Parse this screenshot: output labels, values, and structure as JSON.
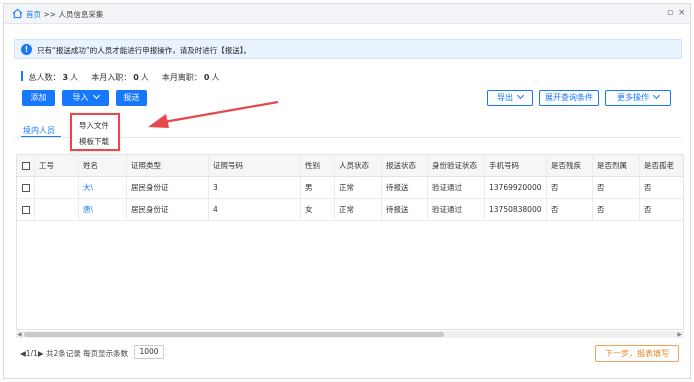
{
  "breadcrumb": {
    "home": "首页",
    "sep": ">>",
    "current": "人员信息采集"
  },
  "window_buttons": {
    "maximize": "▫",
    "close": "×"
  },
  "notice": {
    "icon": "!",
    "text": "只有“报送成功”的人员才能进行申报操作，请及时进行【报送】。"
  },
  "stats": {
    "total_label": "总人数：",
    "total_value": "3",
    "total_unit": "人",
    "hired_label": "本月入职：",
    "hired_value": "0",
    "hired_unit": "人",
    "left_label": "本月离职：",
    "left_value": "0",
    "left_unit": "人"
  },
  "toolbar": {
    "add": "添加",
    "import": "导入",
    "submit": "报送",
    "export": "导出",
    "expand_query": "展开查询条件",
    "more_ops": "更多操作"
  },
  "import_menu": {
    "items": [
      "导入文件",
      "模板下载"
    ]
  },
  "tabs": {
    "active": "境内人员"
  },
  "table": {
    "headers": [
      "工号",
      "姓名",
      "证照类型",
      "证照号码",
      "性别",
      "人员状态",
      "报送状态",
      "身份验证状态",
      "手机号码",
      "是否残疾",
      "是否烈属",
      "是否孤老"
    ],
    "rows": [
      {
        "id": "",
        "name": "大\\",
        "id_type": "居民身份证",
        "id_number": "3",
        "gender": "男",
        "status": "正常",
        "submit_status": "待报送",
        "verify_status": "验证通过",
        "phone": "13769920000",
        "disabled": "否",
        "martyr": "否",
        "lonely": "否"
      },
      {
        "id": "",
        "name": "唐\\",
        "id_type": "居民身份证",
        "id_number": "4",
        "gender": "女",
        "status": "正常",
        "submit_status": "待报送",
        "verify_status": "验证通过",
        "phone": "13750838000",
        "disabled": "否",
        "martyr": "否",
        "lonely": "否"
      }
    ]
  },
  "pager": {
    "text": "◀1/1▶ 共2条记录 每页显示条数",
    "page_size": "1000"
  },
  "next_button": "下一步，报表填写",
  "colors": {
    "primary": "#1677ff",
    "highlight_border": "#e8474c",
    "next_orange": "#e8842a"
  },
  "icons": {
    "home": "home-icon",
    "info": "info-icon",
    "arrow": "red-arrow-icon"
  }
}
